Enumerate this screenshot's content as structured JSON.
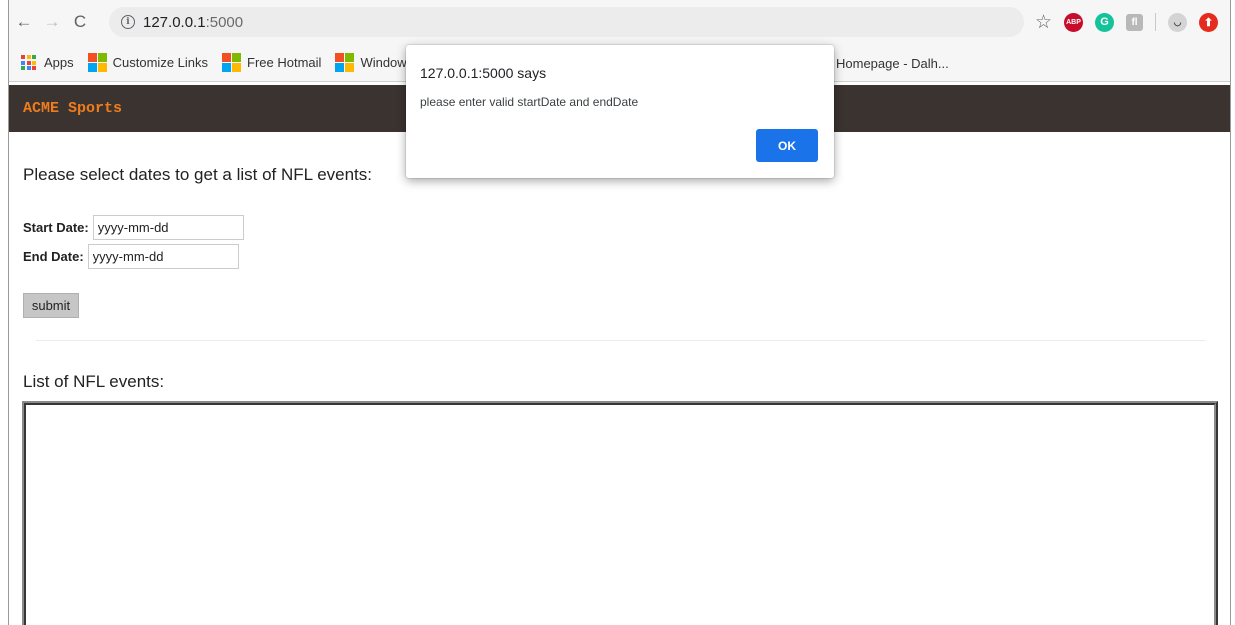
{
  "browser": {
    "url_host": "127.0.0.1",
    "url_port": ":5000",
    "nav": {
      "back": "←",
      "forward": "→",
      "reload": "C"
    },
    "extensions": {
      "abp": "ABP",
      "grammarly": "G",
      "fl": "fl",
      "face": "◡",
      "arrow": "⬆"
    }
  },
  "bookmarks": {
    "apps": "Apps",
    "items": [
      "Customize Links",
      "Free Hotmail",
      "Windows"
    ],
    "far_item": "Homepage - Dalh..."
  },
  "page": {
    "brand": "ACME Sports",
    "prompt": "Please select dates to get a list of NFL events:",
    "start_label": "Start Date:",
    "start_placeholder": "yyyy-mm-dd",
    "end_label": "End Date:",
    "end_placeholder": "yyyy-mm-dd",
    "submit_label": "submit",
    "list_title": "List of NFL events:"
  },
  "dialog": {
    "title": "127.0.0.1:5000 says",
    "message": "please enter valid startDate and endDate",
    "ok_label": "OK"
  },
  "colors": {
    "brand_orange": "#f07c1c",
    "header_bg": "#3a3330",
    "dialog_button": "#1a73e8"
  }
}
